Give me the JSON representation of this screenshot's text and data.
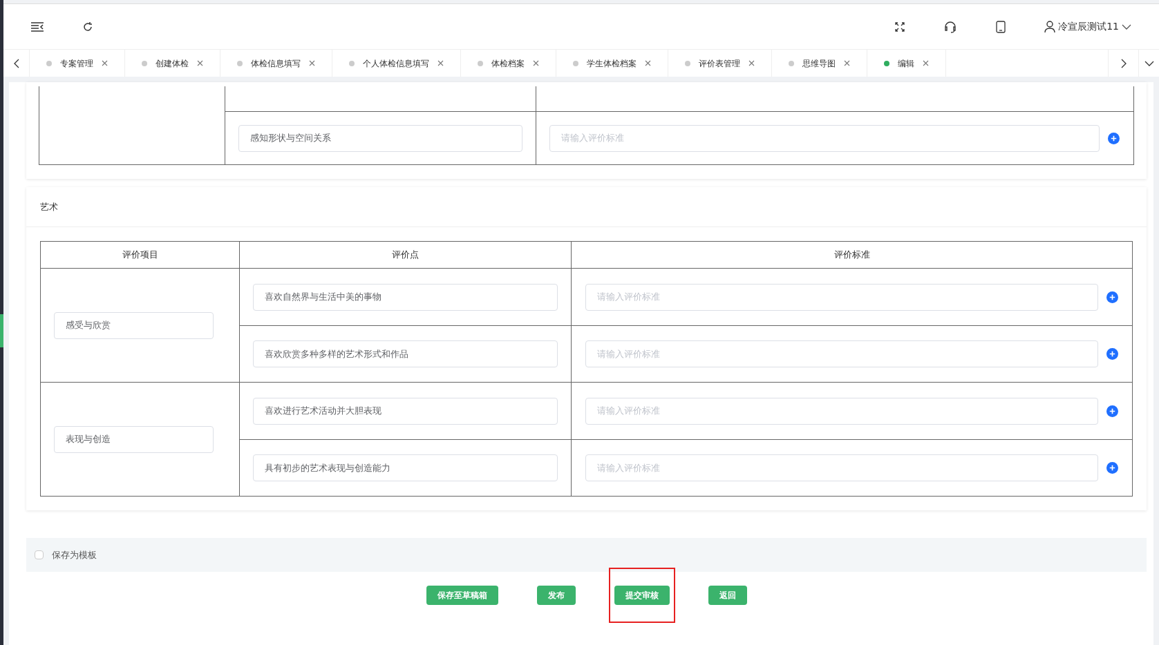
{
  "header": {
    "user": "冷宣辰测试11"
  },
  "tabs": [
    {
      "label": "专案管理",
      "selected": false
    },
    {
      "label": "创建体检",
      "selected": false
    },
    {
      "label": "体检信息填写",
      "selected": false
    },
    {
      "label": "个人体检信息填写",
      "selected": false
    },
    {
      "label": "体检档案",
      "selected": false
    },
    {
      "label": "学生体检档案",
      "selected": false
    },
    {
      "label": "评价表管理",
      "selected": false
    },
    {
      "label": "思维导图",
      "selected": false
    },
    {
      "label": "编辑",
      "selected": true
    }
  ],
  "top_section": {
    "rows": [
      {
        "point": "感知形状与空间关系",
        "placeholder": "请输入评价标准"
      }
    ]
  },
  "art_section": {
    "title": "艺术",
    "columns": [
      "评价项目",
      "评价点",
      "评价标准"
    ],
    "groups": [
      {
        "item": "感受与欣赏",
        "points": [
          {
            "point": "喜欢自然界与生活中美的事物",
            "placeholder": "请输入评价标准"
          },
          {
            "point": "喜欢欣赏多种多样的艺术形式和作品",
            "placeholder": "请输入评价标准"
          }
        ]
      },
      {
        "item": "表现与创造",
        "points": [
          {
            "point": "喜欢进行艺术活动并大胆表现",
            "placeholder": "请输入评价标准"
          },
          {
            "point": "具有初步的艺术表现与创造能力",
            "placeholder": "请输入评价标准"
          }
        ]
      }
    ]
  },
  "save_template": {
    "label": "保存为模板",
    "checked": false
  },
  "buttons": [
    {
      "label": "保存至草稿箱",
      "highlighted": false
    },
    {
      "label": "发布",
      "highlighted": false
    },
    {
      "label": "提交审核",
      "highlighted": true
    },
    {
      "label": "返回",
      "highlighted": false
    }
  ]
}
